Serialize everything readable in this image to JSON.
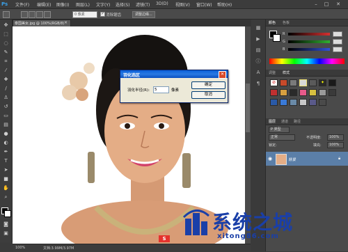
{
  "app": {
    "logo": "Ps"
  },
  "menu": [
    "文件(F)",
    "编辑(E)",
    "图像(I)",
    "图层(L)",
    "文字(Y)",
    "选择(S)",
    "滤镜(T)",
    "3D(D)",
    "视图(V)",
    "窗口(W)",
    "帮助(H)"
  ],
  "window_controls": {
    "minimize": "–",
    "maximize": "□",
    "close": "✕"
  },
  "options": {
    "feather_value": "0 像素",
    "antialias_checked": true,
    "antialias_label": "消除锯齿",
    "refine_edge_label": "调整边缘..."
  },
  "document": {
    "tab_title": "泰国美女.jpg @ 100%(RGB/8)",
    "tab_close": "×"
  },
  "status": {
    "zoom": "100%",
    "doc_info": "文档:3.99M/3.97M"
  },
  "panels": {
    "color_tabs": [
      "颜色",
      "色板"
    ],
    "sliders": [
      {
        "letter": "R",
        "color": "#d83030"
      },
      {
        "letter": "G",
        "color": "#30b030"
      },
      {
        "letter": "B",
        "color": "#3050d8"
      }
    ],
    "adjust_tabs": [
      "调整",
      "样式"
    ],
    "layers_tabs": [
      "图层",
      "通道",
      "路径"
    ],
    "layer_kind": "P 类型",
    "blend_mode": "正常",
    "opacity_label": "不透明度:",
    "opacity_value": "100%",
    "lock_label": "锁定:",
    "fill_label": "填充:",
    "fill_value": "100%",
    "layer_name": "背景"
  },
  "dialog": {
    "title": "羽化选区",
    "close_glyph": "✕",
    "radius_label": "羽化半径(R):",
    "radius_value": "5",
    "unit": "像素",
    "ok_label": "确定",
    "cancel_label": "取消"
  },
  "watermark": {
    "name": "系统之城",
    "url": "xitong86.com",
    "badge": "S"
  },
  "colors": {
    "accent": "#1a3fa8",
    "selection_blue": "#5b7fa8",
    "titlebar": "#0a5fd8"
  }
}
